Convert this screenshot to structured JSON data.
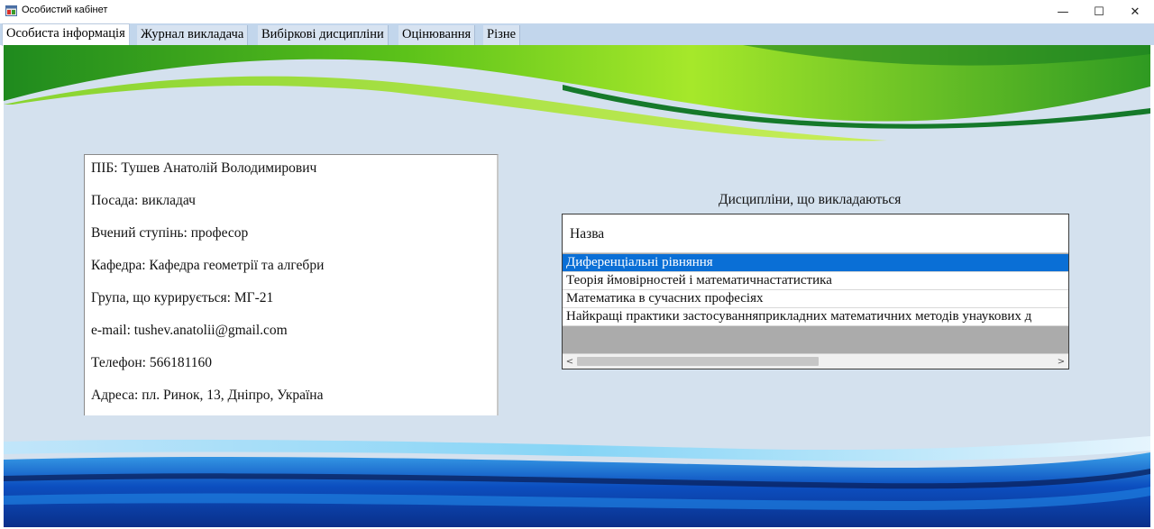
{
  "window": {
    "title": "Особистий кабінет",
    "minimize_glyph": "—",
    "maximize_glyph": "☐",
    "close_glyph": "✕"
  },
  "tabs": [
    {
      "label": "Особиста інформація",
      "active": true
    },
    {
      "label": "Журнал викладача",
      "active": false
    },
    {
      "label": "Вибіркові дисципліни",
      "active": false
    },
    {
      "label": "Оцінювання",
      "active": false
    },
    {
      "label": "Різне",
      "active": false
    }
  ],
  "profile": {
    "lines": [
      "ПІБ: Тушев Анатолій Володимирович",
      "Посада: викладач",
      "Вчений ступінь: професор",
      "Кафедра: Кафедра геометрії та алгебри",
      "Група, що курирується: МГ-21",
      "e-mail: tushev.anatolii@gmail.com",
      "Телефон: 566181160",
      "Адреса: пл. Ринок, 13, Дніпро, Україна"
    ]
  },
  "disciplines": {
    "title": "Дисципліни, що викладаються",
    "column_header": "Назва",
    "rows": [
      "Диференціальні рівняння",
      "Теорія ймовірностей і математичнастатистика",
      "Математика в сучасних професіях",
      "Найкращі практики застосуванняприкладних математичних методів унаукових д"
    ],
    "selected_index": 0,
    "scroll_left_glyph": "<",
    "scroll_right_glyph": ">"
  },
  "colors": {
    "selection": "#0a6fd6",
    "panel_background": "#d4e1ee",
    "tabstrip": "#c2d6ec",
    "green_wave": "#6fcf1a",
    "blue_wave": "#0a3a9a"
  },
  "icons": {
    "app": "window-app-icon",
    "minimize": "minimize-icon",
    "maximize": "maximize-icon",
    "close": "close-icon"
  }
}
